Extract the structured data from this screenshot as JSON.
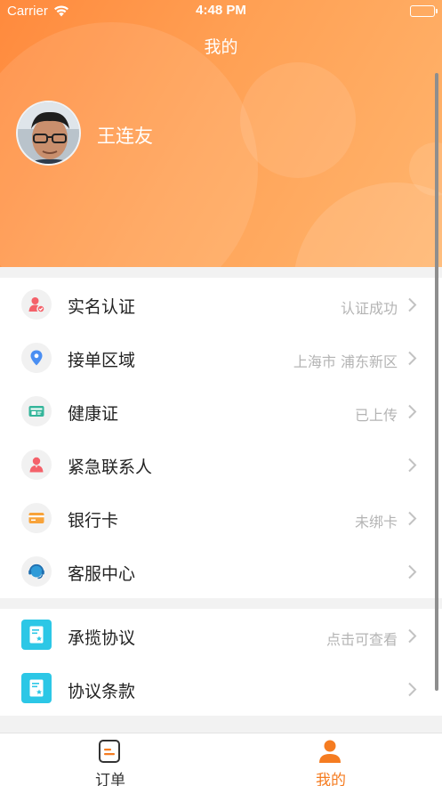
{
  "status_bar": {
    "carrier": "Carrier",
    "time": "4:48 PM"
  },
  "page_title": "我的",
  "user": {
    "name": "王连友"
  },
  "menu": [
    {
      "label": "实名认证",
      "value": "认证成功",
      "icon": "user-verified-icon"
    },
    {
      "label": "接单区域",
      "value": "上海市 浦东新区",
      "icon": "location-pin-icon"
    },
    {
      "label": "健康证",
      "value": "已上传",
      "icon": "health-card-icon"
    },
    {
      "label": "紧急联系人",
      "value": "",
      "icon": "contact-person-icon"
    },
    {
      "label": "银行卡",
      "value": "未绑卡",
      "icon": "bank-card-icon"
    },
    {
      "label": "客服中心",
      "value": "",
      "icon": "headset-icon"
    }
  ],
  "agreements": [
    {
      "label": "承揽协议",
      "value": "点击可查看",
      "icon": "document-star-icon"
    },
    {
      "label": "协议条款",
      "value": "",
      "icon": "document-star-icon"
    }
  ],
  "tabbar": {
    "orders_label": "订单",
    "me_label": "我的"
  },
  "colors": {
    "accent": "#f57c21",
    "header_start": "#ff8a3d",
    "header_end": "#ffb56e",
    "agreement_icon": "#2cc7e6"
  }
}
